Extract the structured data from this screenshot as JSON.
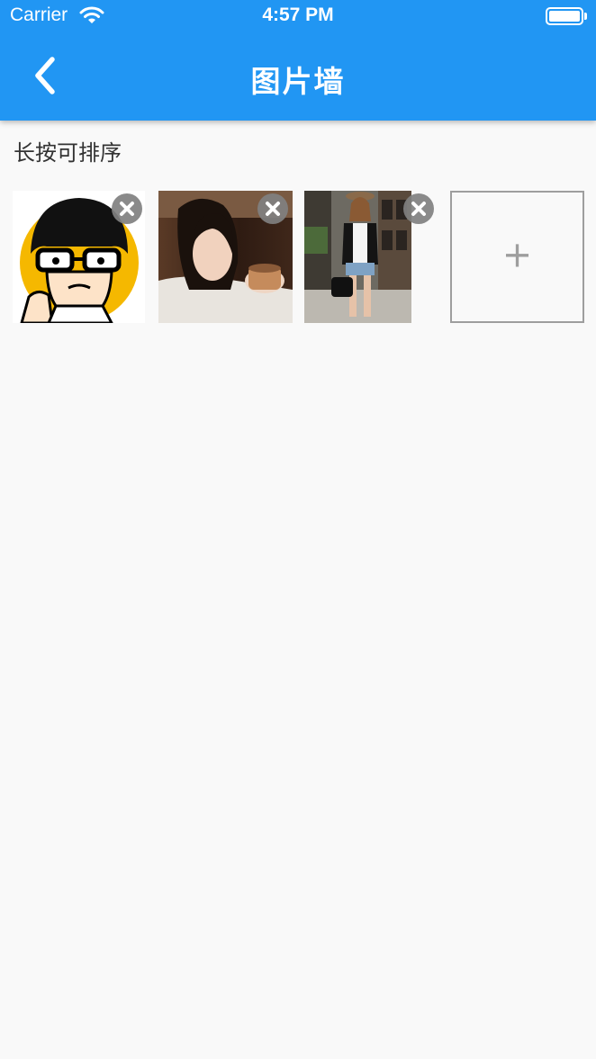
{
  "status_bar": {
    "carrier": "Carrier",
    "time": "4:57 PM"
  },
  "header": {
    "title": "图片墙",
    "back_icon": "chevron-left-icon"
  },
  "hint": "长按可排序",
  "photos": [
    {
      "subject": "cartoon avatar",
      "delete_icon": "close-icon"
    },
    {
      "subject": "woman with coffee cup",
      "delete_icon": "close-icon"
    },
    {
      "subject": "woman on street",
      "delete_icon": "close-icon"
    }
  ],
  "add_tile": {
    "label": "+"
  },
  "colors": {
    "primary": "#2196f3",
    "background": "#f9f9f9",
    "delete_bg": "#808080",
    "tile_border": "#9e9e9e"
  }
}
